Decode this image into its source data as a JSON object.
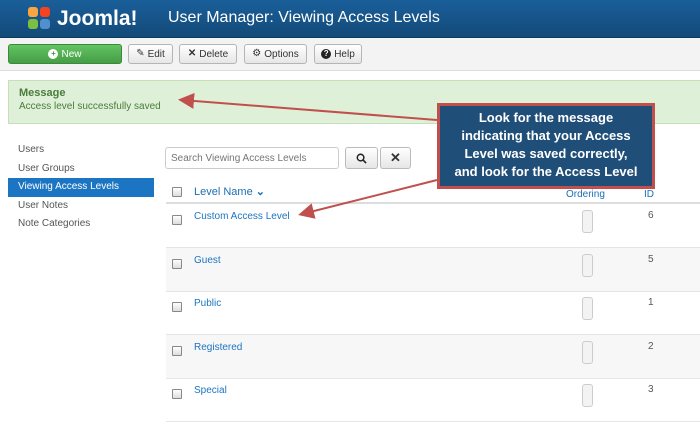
{
  "header": {
    "logo_text": "Joomla!",
    "title": "User Manager: Viewing Access Levels"
  },
  "toolbar": {
    "new_label": "New",
    "edit_label": "Edit",
    "delete_label": "Delete",
    "options_label": "Options",
    "help_label": "Help"
  },
  "message": {
    "heading": "Message",
    "text": "Access level successfully saved"
  },
  "sidebar": {
    "items": [
      {
        "label": "Users"
      },
      {
        "label": "User Groups"
      },
      {
        "label": "Viewing Access Levels",
        "active": true
      },
      {
        "label": "User Notes"
      },
      {
        "label": "Note Categories"
      }
    ]
  },
  "search": {
    "placeholder": "Search Viewing Access Levels"
  },
  "table": {
    "col_name": "Level Name",
    "col_ordering": "Ordering",
    "col_id": "ID",
    "rows": [
      {
        "name": "Custom Access Level",
        "id": "6"
      },
      {
        "name": "Guest",
        "id": "5"
      },
      {
        "name": "Public",
        "id": "1"
      },
      {
        "name": "Registered",
        "id": "2"
      },
      {
        "name": "Special",
        "id": "3"
      }
    ]
  },
  "callout": {
    "lines": [
      "Look for the message",
      "indicating that your Access",
      "Level was saved correctly,",
      "and look for the Access Level"
    ]
  },
  "colors": {
    "header": "#17568c",
    "accent": "#1c75c2",
    "success_bg": "#dff0d8",
    "callout_bg": "#1f4e79",
    "callout_border": "#c0504d"
  }
}
